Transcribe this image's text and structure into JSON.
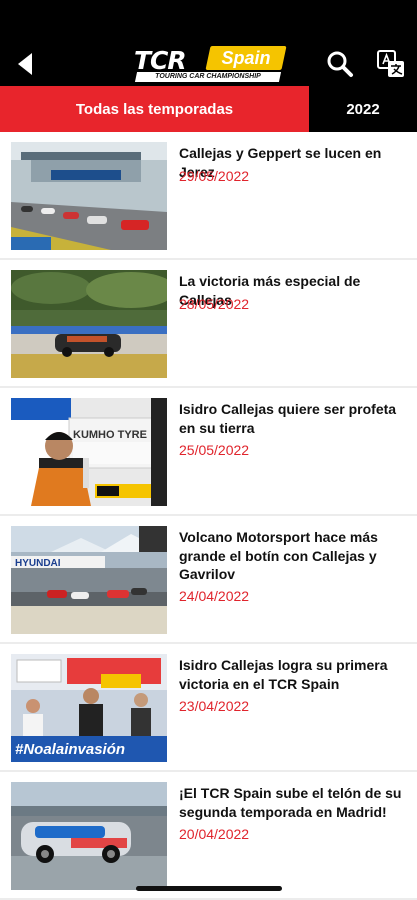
{
  "header": {
    "logo": {
      "brand": "TCR",
      "region": "Spain",
      "tagline": "TOURING CAR CHAMPIONSHIP"
    },
    "icons": {
      "back": "back-arrow-icon",
      "search": "search-icon",
      "translate": "translate-icon"
    },
    "colors": {
      "bar": "#000000",
      "accent": "#e8252c",
      "logo_yellow": "#f5c400"
    }
  },
  "tabs": [
    {
      "label": "Todas las temporadas",
      "active": true
    },
    {
      "label": "2022",
      "active": false
    }
  ],
  "news": [
    {
      "title": "Callejas y Geppert se lucen en Jerez",
      "date": "29/05/2022"
    },
    {
      "title": "La victoria más especial de Callejas",
      "date": "28/05/2022"
    },
    {
      "title": "Isidro Callejas quiere ser profeta en su tierra",
      "date": "25/05/2022"
    },
    {
      "title": "Volcano Motorsport hace más grande el botín con Callejas y Gavrilov",
      "date": "24/04/2022"
    },
    {
      "title": "Isidro Callejas logra su primera victoria en el TCR Spain",
      "date": "23/04/2022"
    },
    {
      "title": "¡El TCR Spain sube el telón de su segunda temporada en Madrid!",
      "date": "20/04/2022"
    }
  ],
  "thumb_text": {
    "kumho": "KUMHO TYRE",
    "hyundai": "HYUNDAI",
    "banner": "#Noalainvasión"
  }
}
